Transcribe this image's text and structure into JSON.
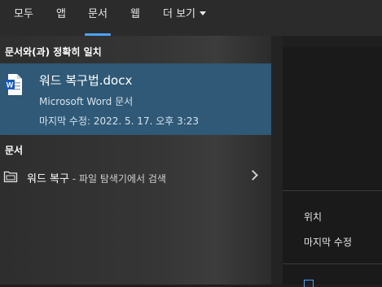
{
  "tabs": [
    {
      "label": "모두"
    },
    {
      "label": "앱"
    },
    {
      "label": "문서",
      "active": true
    },
    {
      "label": "웹"
    },
    {
      "label": "더 보기"
    }
  ],
  "best_match": {
    "section_title": "문서와(과) 정확히 일치",
    "title": "워드 복구법.docx",
    "subtitle": "Microsoft Word 문서",
    "modified": "마지막 수정: 2022. 5. 17. 오후 3:23",
    "icon": "word-document-icon"
  },
  "documents": {
    "section_title": "문서",
    "items": [
      {
        "name": "워드 복구",
        "description": " - 파일 탐색기에서 검색",
        "icon": "folder-search-icon"
      }
    ]
  },
  "preview": {
    "labels": [
      "위치",
      "마지막 수정"
    ]
  },
  "colors": {
    "accent": "#4aa3ff",
    "selected_bg": "#2f5977",
    "word_blue": "#185abd"
  }
}
